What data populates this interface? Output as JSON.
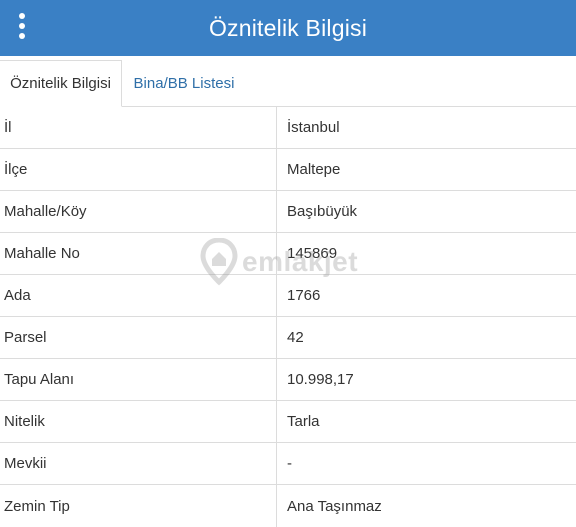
{
  "header": {
    "title": "Öznitelik Bilgisi",
    "menu_icon": "more-vertical-icon"
  },
  "tabs": [
    {
      "label": "Öznitelik Bilgisi",
      "active": true
    },
    {
      "label": "Bina/BB Listesi",
      "active": false
    }
  ],
  "attributes": [
    {
      "key": "İl",
      "value": "İstanbul"
    },
    {
      "key": "İlçe",
      "value": "Maltepe"
    },
    {
      "key": "Mahalle/Köy",
      "value": "Başıbüyük"
    },
    {
      "key": "Mahalle No",
      "value": "145869"
    },
    {
      "key": "Ada",
      "value": "1766"
    },
    {
      "key": "Parsel",
      "value": "42"
    },
    {
      "key": "Tapu Alanı",
      "value": "10.998,17"
    },
    {
      "key": "Nitelik",
      "value": "Tarla"
    },
    {
      "key": "Mevkii",
      "value": "-"
    },
    {
      "key": "Zemin Tip",
      "value": "Ana Taşınmaz"
    }
  ],
  "watermark": {
    "text": "emlakjet",
    "icon": "location-pin-icon"
  },
  "colors": {
    "header_bg": "#3a80c5",
    "tab_link": "#2f6fa8",
    "border": "#dcdcdc",
    "text": "#333333"
  }
}
